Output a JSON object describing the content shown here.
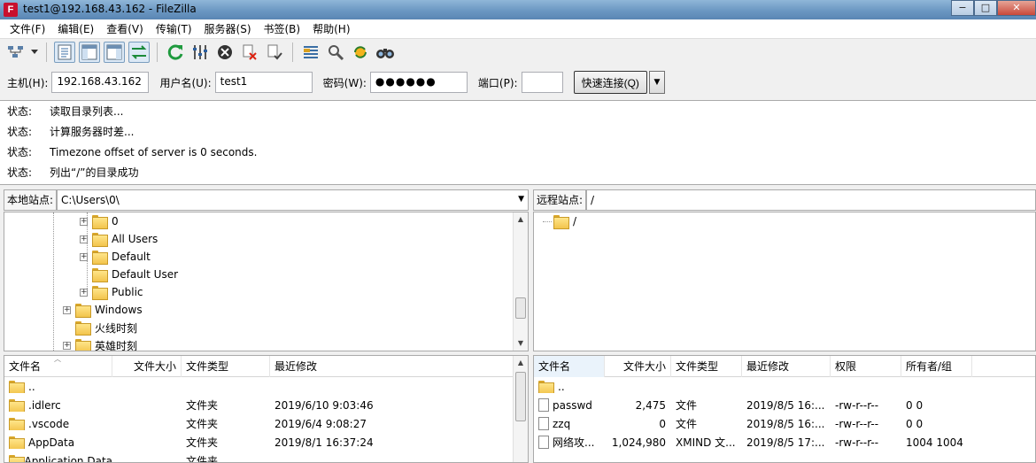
{
  "window": {
    "title": "test1@192.168.43.162 - FileZilla",
    "app_icon": "F",
    "minimize": "−",
    "maximize": "□",
    "close": "✕"
  },
  "menu": [
    "文件(F)",
    "编辑(E)",
    "查看(V)",
    "传输(T)",
    "服务器(S)",
    "书签(B)",
    "帮助(H)"
  ],
  "toolbar": [
    "site-manager-icon",
    "dropdown-icon",
    "toggle-log-icon",
    "toggle-local-tree-icon",
    "toggle-remote-tree-icon",
    "toggle-queue-icon",
    "refresh-icon",
    "process-queue-icon",
    "cancel-icon",
    "disconnect-icon",
    "reconnect-icon",
    "filter-icon",
    "compare-icon",
    "sync-browse-icon",
    "search-icon"
  ],
  "quickconnect": {
    "host_label": "主机(H):",
    "host_value": "192.168.43.162",
    "user_label": "用户名(U):",
    "user_value": "test1",
    "pass_label": "密码(W):",
    "pass_value": "●●●●●●",
    "port_label": "端口(P):",
    "port_value": "",
    "connect_label": "快速连接(Q)",
    "dropdown": "▼"
  },
  "log": [
    {
      "type": "状态:",
      "text": "读取目录列表..."
    },
    {
      "type": "状态:",
      "text": "计算服务器时差..."
    },
    {
      "type": "状态:",
      "text": "Timezone offset of server is 0 seconds."
    },
    {
      "type": "状态:",
      "text": "列出“/”的目录成功"
    }
  ],
  "local_site": {
    "label": "本地站点:",
    "path": "C:\\Users\\0\\"
  },
  "remote_site": {
    "label": "远程站点:",
    "path": "/"
  },
  "local_tree": [
    "0",
    "All Users",
    "Default",
    "Default User",
    "Public",
    "Windows",
    "火线时刻",
    "英雄时刻"
  ],
  "remote_tree": [
    "/"
  ],
  "local_columns": {
    "name": "文件名",
    "size": "文件大小",
    "type": "文件类型",
    "modified": "最近修改"
  },
  "local_files": [
    {
      "name": "..",
      "size": "",
      "type": "",
      "modified": ""
    },
    {
      "name": ".idlerc",
      "size": "",
      "type": "文件夹",
      "modified": "2019/6/10 9:03:46"
    },
    {
      "name": ".vscode",
      "size": "",
      "type": "文件夹",
      "modified": "2019/6/4 9:08:27"
    },
    {
      "name": "AppData",
      "size": "",
      "type": "文件夹",
      "modified": "2019/8/1 16:37:24"
    },
    {
      "name": "Application Data",
      "size": "",
      "type": "文件夹",
      "modified": ""
    }
  ],
  "remote_columns": {
    "name": "文件名",
    "size": "文件大小",
    "type": "文件类型",
    "modified": "最近修改",
    "perms": "权限",
    "owner": "所有者/组"
  },
  "remote_files": [
    {
      "name": "..",
      "size": "",
      "type": "",
      "modified": "",
      "perms": "",
      "owner": "",
      "icon": "folder"
    },
    {
      "name": "passwd",
      "size": "2,475",
      "type": "文件",
      "modified": "2019/8/5 16:...",
      "perms": "-rw-r--r--",
      "owner": "0 0",
      "icon": "file"
    },
    {
      "name": "zzq",
      "size": "0",
      "type": "文件",
      "modified": "2019/8/5 16:...",
      "perms": "-rw-r--r--",
      "owner": "0 0",
      "icon": "file"
    },
    {
      "name": "网络攻...",
      "size": "1,024,980",
      "type": "XMIND 文...",
      "modified": "2019/8/5 17:...",
      "perms": "-rw-r--r--",
      "owner": "1004 1004",
      "icon": "file"
    }
  ]
}
